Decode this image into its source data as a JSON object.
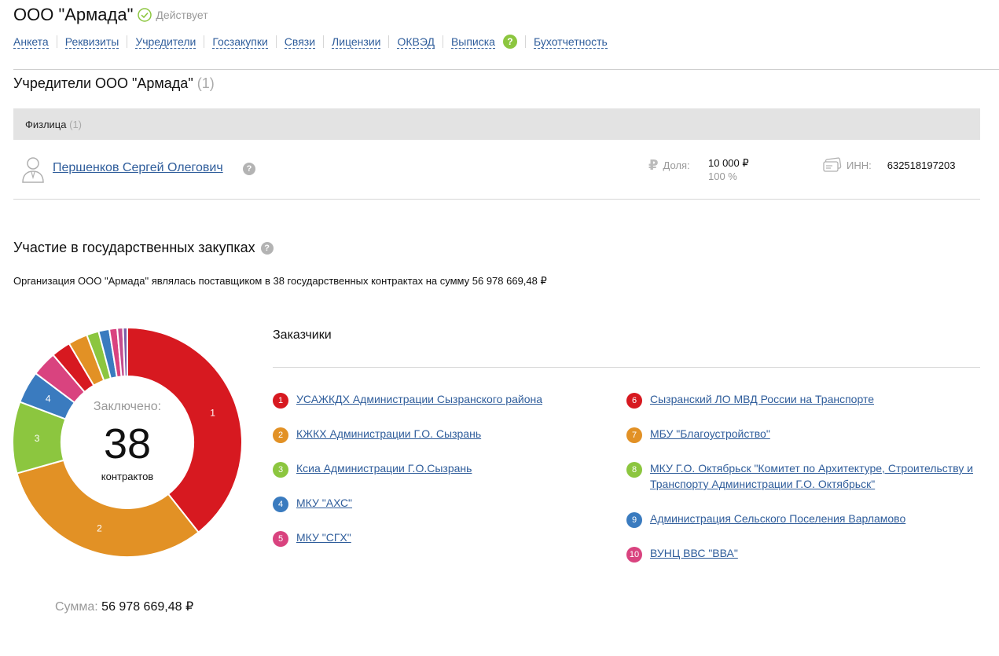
{
  "company": {
    "title": "ООО \"Армада\"",
    "status": "Действует",
    "status_color": "#8cc63f"
  },
  "tabs": [
    {
      "label": "Анкета"
    },
    {
      "label": "Реквизиты"
    },
    {
      "label": "Учредители"
    },
    {
      "label": "Госзакупки"
    },
    {
      "label": "Связи"
    },
    {
      "label": "Лицензии"
    },
    {
      "label": "ОКВЭД"
    },
    {
      "label": "Выписка"
    },
    {
      "label": "Бухотчетность"
    }
  ],
  "tabs_help_icon": "?",
  "founders": {
    "title": "Учредители ООО \"Армада\"",
    "count": "(1)",
    "group_label": "Физлица",
    "group_count": "(1)",
    "person": {
      "name": "Першенков Сергей Олегович",
      "help": "?",
      "share_label": "Доля:",
      "share_value": "10 000 ₽",
      "share_percent": "100 %",
      "inn_label": "ИНН:",
      "inn_value": "632518197203"
    }
  },
  "gz": {
    "title": "Участие в государственных закупках",
    "help": "?",
    "description": "Организация ООО \"Армада\" являлась поставщиком в 38 государственных контрактах на сумму 56 978 669,48 ₽",
    "center_label": "Заключено:",
    "center_number": "38",
    "center_unit": "контрактов",
    "sum_label": "Сумма:",
    "sum_value": "56 978 669,48 ₽",
    "customers_title": "Заказчики"
  },
  "chart_data": {
    "type": "pie",
    "total_contracts": 38,
    "slices": [
      {
        "label": "1",
        "value": 39,
        "color": "#d71920",
        "show_label": true
      },
      {
        "label": "2",
        "value": 31,
        "color": "#e29125",
        "show_label": true
      },
      {
        "label": "3",
        "value": 10,
        "color": "#8cc63f",
        "show_label": true
      },
      {
        "label": "4",
        "value": 4.5,
        "color": "#3a7bbf",
        "show_label": true
      },
      {
        "label": "5",
        "value": 3.5,
        "color": "#d9437f",
        "show_label": false
      },
      {
        "label": "6",
        "value": 2.7,
        "color": "#d71920",
        "show_label": false
      },
      {
        "label": "7",
        "value": 2.7,
        "color": "#e29125",
        "show_label": false
      },
      {
        "label": "8",
        "value": 1.7,
        "color": "#8cc63f",
        "show_label": false
      },
      {
        "label": "9",
        "value": 1.5,
        "color": "#3a7bbf",
        "show_label": false
      },
      {
        "label": "10",
        "value": 1.1,
        "color": "#d9437f",
        "show_label": false
      },
      {
        "label": "",
        "value": 0.8,
        "color": "#c44d8e",
        "show_label": false
      },
      {
        "label": "",
        "value": 0.6,
        "color": "#7b5ea7",
        "show_label": false
      }
    ]
  },
  "customers": [
    {
      "num": "1",
      "name": "УСАЖКДХ Администрации Сызранского района",
      "color": "#d71920"
    },
    {
      "num": "2",
      "name": "КЖКХ Администрации Г.О. Сызрань",
      "color": "#e29125"
    },
    {
      "num": "3",
      "name": "Ксиа Администрации Г.О.Сызрань",
      "color": "#8cc63f"
    },
    {
      "num": "4",
      "name": "МКУ \"АХС\"",
      "color": "#3a7bbf"
    },
    {
      "num": "5",
      "name": "МКУ \"СГХ\"",
      "color": "#d9437f"
    },
    {
      "num": "6",
      "name": "Сызранский ЛО МВД России на Транспорте",
      "color": "#d71920"
    },
    {
      "num": "7",
      "name": "МБУ \"Благоустройство\"",
      "color": "#e29125"
    },
    {
      "num": "8",
      "name": "МКУ Г.О. Октябрьск \"Комитет по Архитектуре, Строительству и Транспорту Администрации Г.О. Октябрьск\"",
      "color": "#8cc63f"
    },
    {
      "num": "9",
      "name": "Администрация Сельского Поселения Варламово",
      "color": "#3a7bbf"
    },
    {
      "num": "10",
      "name": "ВУНЦ ВВС \"ВВА\"",
      "color": "#d9437f"
    }
  ]
}
